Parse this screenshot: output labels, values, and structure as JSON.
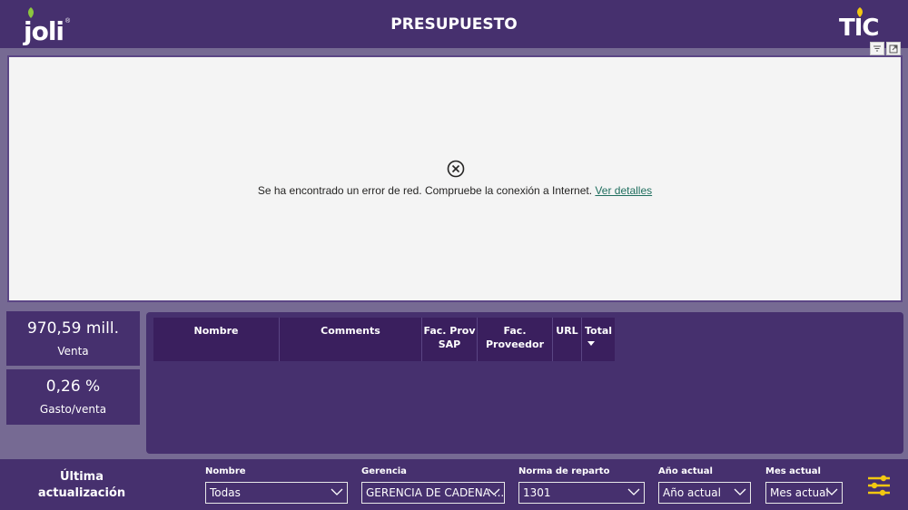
{
  "header": {
    "logo_left": "joli",
    "title": "PRESUPUESTO",
    "logo_right": "TIC"
  },
  "visual_tools": [
    "filter-icon",
    "focus-mode-icon"
  ],
  "error": {
    "message": "Se ha encontrado un error de red. Compruebe la conexión a Internet.",
    "link": "Ver detalles"
  },
  "kpis": [
    {
      "value": "970,59 mill.",
      "label": "Venta"
    },
    {
      "value": "0,26 %",
      "label": "Gasto/venta"
    }
  ],
  "table": {
    "columns": [
      {
        "label": "Nombre"
      },
      {
        "label": "Comments"
      },
      {
        "label": "Fac. Prov SAP"
      },
      {
        "label": "Fac. Proveedor"
      },
      {
        "label": "URL"
      },
      {
        "label": "Total"
      }
    ],
    "sorted_column": "Total",
    "sort_direction": "descending"
  },
  "footer": {
    "last_update": "Última actualización",
    "slicers": [
      {
        "label": "Nombre",
        "value": "Todas"
      },
      {
        "label": "Gerencia",
        "value": "GERENCIA DE CADENA ..."
      },
      {
        "label": "Norma de reparto",
        "value": "1301"
      },
      {
        "label": "Año actual",
        "value": "Año actual"
      },
      {
        "label": "Mes actual",
        "value": "Mes actual"
      }
    ]
  },
  "colors": {
    "header_bg": "#46306e",
    "page_bg": "#766a93",
    "table_header_bg": "#3a1f5e",
    "accent_yellow": "#f2c811",
    "logo_green": "#8cc63f",
    "link_teal": "#1f6e5e"
  }
}
